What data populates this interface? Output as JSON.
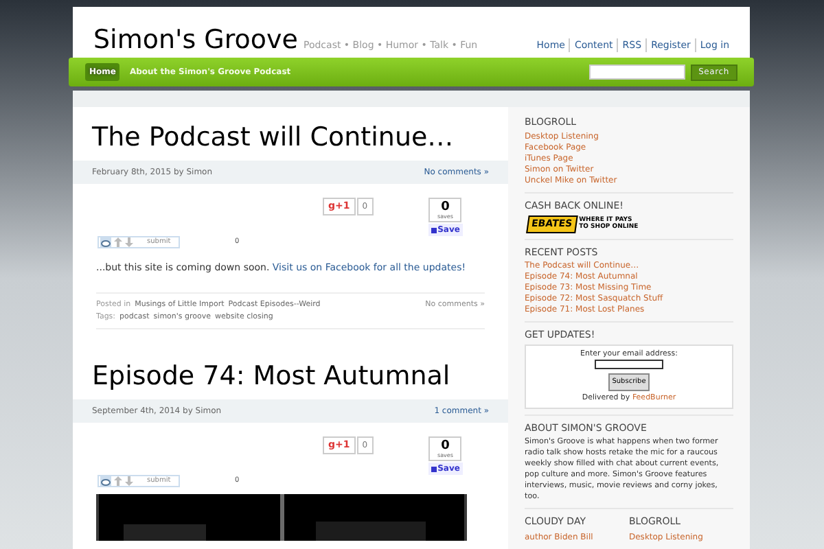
{
  "site": {
    "title": "Simon's Groove",
    "tagline": "Podcast • Blog • Humor • Talk • Fun",
    "top_links": [
      "Home",
      "Content",
      "RSS",
      "Register",
      "Log in"
    ]
  },
  "nav": {
    "items": [
      {
        "label": "Home",
        "selected": true
      },
      {
        "label": "About the Simon's Groove Podcast",
        "selected": false
      }
    ],
    "search_button": "Search"
  },
  "posts": [
    {
      "title": "The Podcast will Continue…",
      "meta": "February 8th, 2015 by Simon",
      "comments": "No comments »",
      "gplus": "g+1",
      "gplus_count": "0",
      "saves_count": "0",
      "saves_label": "saves",
      "save_button": "Save",
      "reddit_submit": "submit",
      "reddit_score": "0",
      "body_text": "...but this site is coming down soon.",
      "body_link": "Visit us on Facebook for all the updates!",
      "posted_in_label": "Posted in",
      "categories": [
        "Musings of Little Import",
        "Podcast Episodes--Weird"
      ],
      "tags_label": "Tags:",
      "tags": [
        "podcast",
        "simon's groove",
        "website closing"
      ],
      "footer_comments": "No comments »"
    },
    {
      "title": "Episode 74: Most Autumnal",
      "meta": "September 4th, 2014 by Simon",
      "comments": "1 comment »",
      "gplus": "g+1",
      "gplus_count": "0",
      "saves_count": "0",
      "saves_label": "saves",
      "save_button": "Save",
      "reddit_submit": "submit",
      "reddit_score": "0"
    }
  ],
  "sidebar": {
    "blogroll": {
      "title": "BLOGROLL",
      "links": [
        "Desktop Listening",
        "Facebook Page",
        "iTunes Page",
        "Simon on Twitter",
        "Unckel Mike on Twitter"
      ]
    },
    "cashback": {
      "title": "CASH BACK ONLINE!",
      "logo": "EBATES",
      "slogan_1": "WHERE IT PAYS",
      "slogan_2": "TO SHOP ONLINE"
    },
    "recent": {
      "title": "RECENT POSTS",
      "links": [
        "The Podcast will Continue…",
        "Episode 74: Most Autumnal",
        "Episode 73: Most Missing Time",
        "Episode 72: Most Sasquatch Stuff",
        "Episode 71: Most Lost Planes"
      ]
    },
    "updates": {
      "title": "GET UPDATES!",
      "prompt": "Enter your email address:",
      "button": "Subscribe",
      "delivered": "Delivered by",
      "delivered_link": "FeedBurner"
    },
    "about": {
      "title": "ABOUT SIMON'S GROOVE",
      "text": "Simon's Groove is what happens when two former radio talk show hosts retake the mic for a raucous weekly show filled with chat about current events, pop culture and more. Simon's Groove features interviews, music, movie reviews and corny jokes, too."
    },
    "cloudy": {
      "title": "CLOUDY DAY",
      "links": [
        "author Biden Bill"
      ]
    },
    "blogroll2": {
      "title": "BLOGROLL",
      "links": [
        "Desktop Listening"
      ]
    }
  }
}
